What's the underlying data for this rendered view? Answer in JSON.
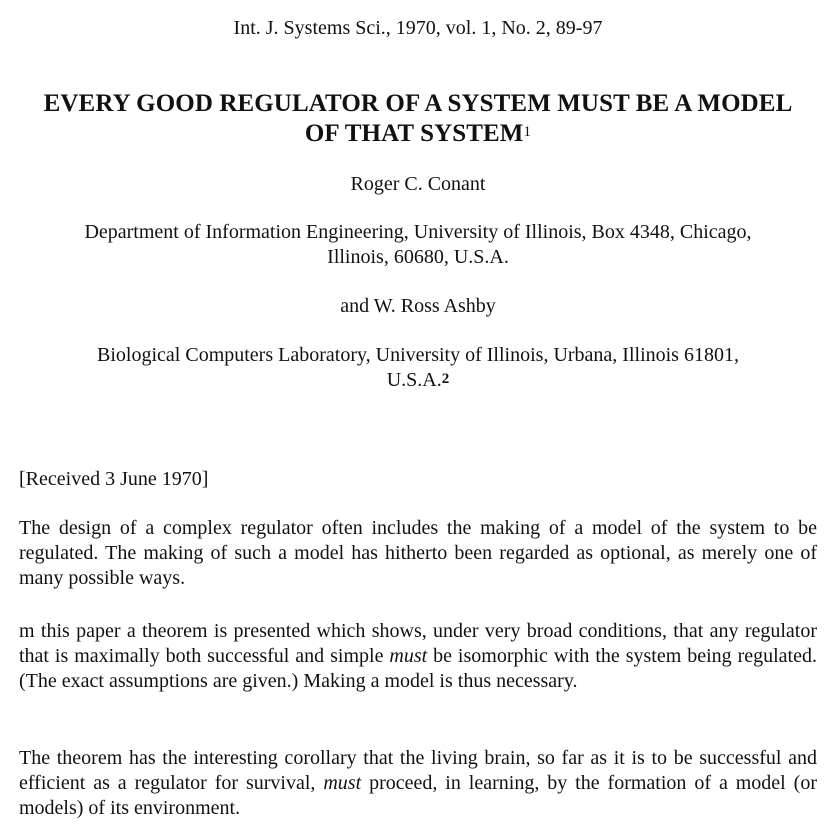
{
  "journal_line": "Int. J. Systems Sci., 1970, vol. 1, No. 2, 89-97",
  "title": {
    "line1": "EVERY GOOD REGULATOR OF A SYSTEM MUST BE A MODEL",
    "line2": "OF THAT SYSTEM",
    "footnote_mark": "1"
  },
  "authors": {
    "first": "Roger C. Conant",
    "first_affiliation_line1": "Department of Information Engineering, University of Illinois, Box 4348, Chicago,",
    "first_affiliation_line2": "Illinois, 60680, U.S.A.",
    "second": "and W. Ross Ashby",
    "second_affiliation_line1": "Biological Computers Laboratory, University of Illinois, Urbana, Illinois 61801,",
    "second_affiliation_line2": "U.S.A.",
    "second_footnote_mark": "2"
  },
  "received": "[Received 3 June 1970]",
  "abstract": {
    "p1": "The design of a complex regulator often includes the making of a model of the system to be regulated. The making of such a model has hitherto been regarded as optional, as merely one of many possible ways.",
    "p2_before": "m this paper a theorem is presented which shows, under very broad conditions, that any regulator that is maximally both successful and simple ",
    "p2_em": "must",
    "p2_after": " be isomorphic with the system being regulated. (The exact assumptions are given.) Making a model is thus necessary.",
    "p3_before": "The theorem has the interesting corollary that the living brain, so far as it is to be successful and efficient as a regulator for survival, ",
    "p3_em": "must",
    "p3_after": " proceed, in learning, by the formation of a model (or models) of its environment."
  }
}
